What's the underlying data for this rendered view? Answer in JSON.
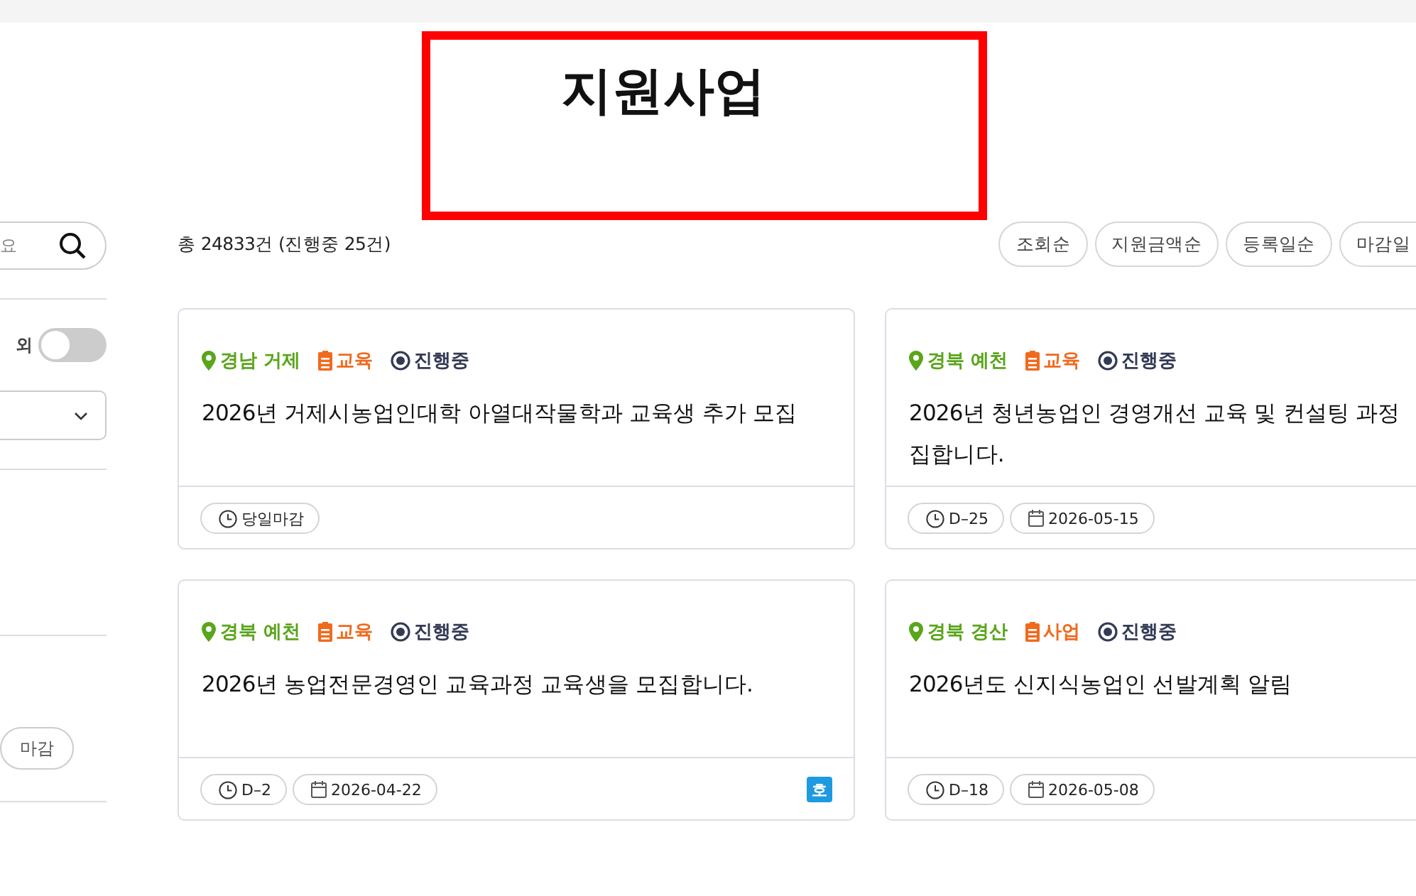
{
  "header": {
    "title": "지원사업",
    "highlighted": true
  },
  "sidebar": {
    "search": {
      "placeholder": "요"
    },
    "toggle": {
      "label": "외",
      "on": false
    },
    "chip": "마감"
  },
  "results": {
    "count": "총 24833건 (진행중 25건)",
    "sort_options": [
      "조회순",
      "지원금액순",
      "등록일순",
      "마감일"
    ]
  },
  "cards": [
    {
      "region": "경남 거제",
      "category": "교육",
      "status": "진행중",
      "title_lines": [
        "2026년 거제시농업인대학 아열대작물학과 교육생 추가 모집"
      ],
      "deadline": "당일마감"
    },
    {
      "region": "경북 예천",
      "category": "교육",
      "status": "진행중",
      "title_lines": [
        "2026년 청년농업인 경영개선 교육 및 컨설팅 과정",
        "집합니다."
      ],
      "deadline": "D–25",
      "date": "2026-05-15"
    },
    {
      "region": "경북 예천",
      "category": "교육",
      "status": "진행중",
      "title_lines": [
        "2026년 농업전문경영인 교육과정 교육생을 모집합니다."
      ],
      "deadline": "D–2",
      "date": "2026-04-22",
      "badge": "호"
    },
    {
      "region": "경북 경산",
      "category": "사업",
      "status": "진행중",
      "title_lines": [
        "2026년도 신지식농업인 선발계획 알림"
      ],
      "deadline": "D–18",
      "date": "2026-05-08"
    }
  ]
}
